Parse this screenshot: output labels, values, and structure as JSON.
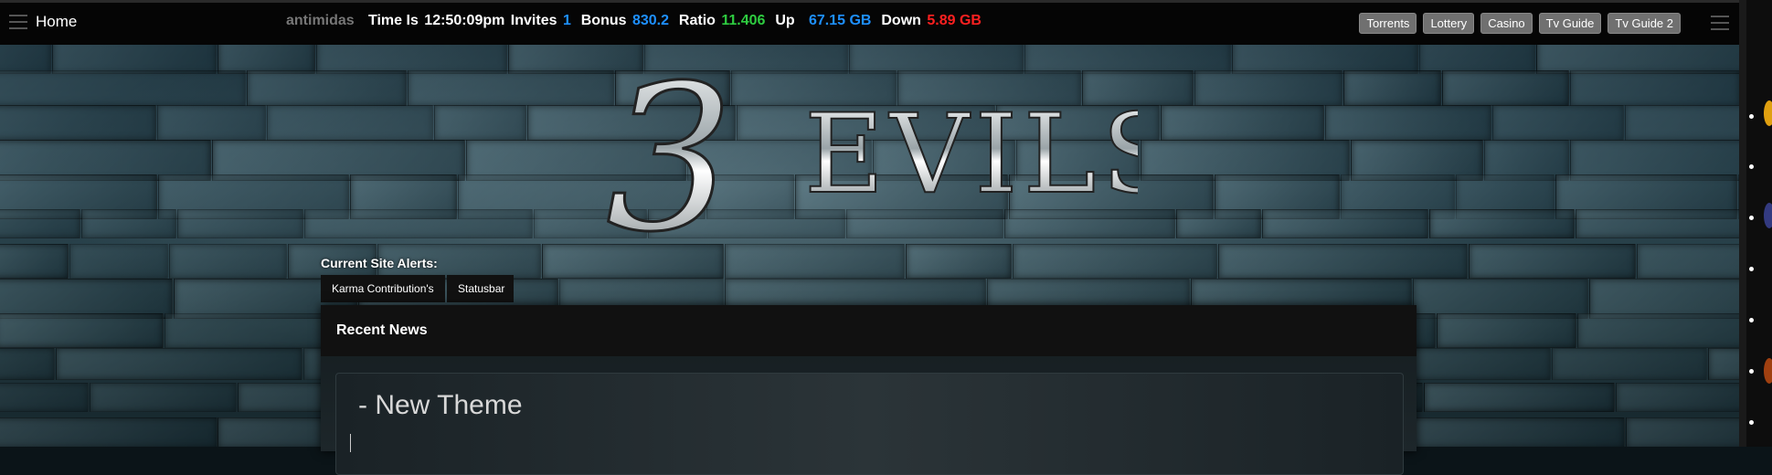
{
  "topbar": {
    "home_label": "Home",
    "username": "antimidas",
    "time_label": "Time Is",
    "time_value": "12:50:09pm",
    "invites_label": "Invites",
    "invites_value": "1",
    "bonus_label": "Bonus",
    "bonus_value": "830.2",
    "ratio_label": "Ratio",
    "ratio_value": "11.406",
    "up_label": "Up",
    "up_value": "67.15 GB",
    "down_label": "Down",
    "down_value": "5.89 GB",
    "nav_buttons": [
      "Torrents",
      "Lottery",
      "Casino",
      "Tv Guide",
      "Tv Guide 2"
    ]
  },
  "logo": {
    "text_number": "3",
    "text_word": "EVILS"
  },
  "alerts": {
    "title": "Current Site Alerts:",
    "tabs": [
      "Karma Contribution's",
      "Statusbar"
    ]
  },
  "news": {
    "header": "Recent News",
    "first_item_title": "- New Theme"
  },
  "colors": {
    "accent_blue": "#1e90ff",
    "ratio_green": "#2ecc40",
    "down_red": "#ff2020"
  }
}
